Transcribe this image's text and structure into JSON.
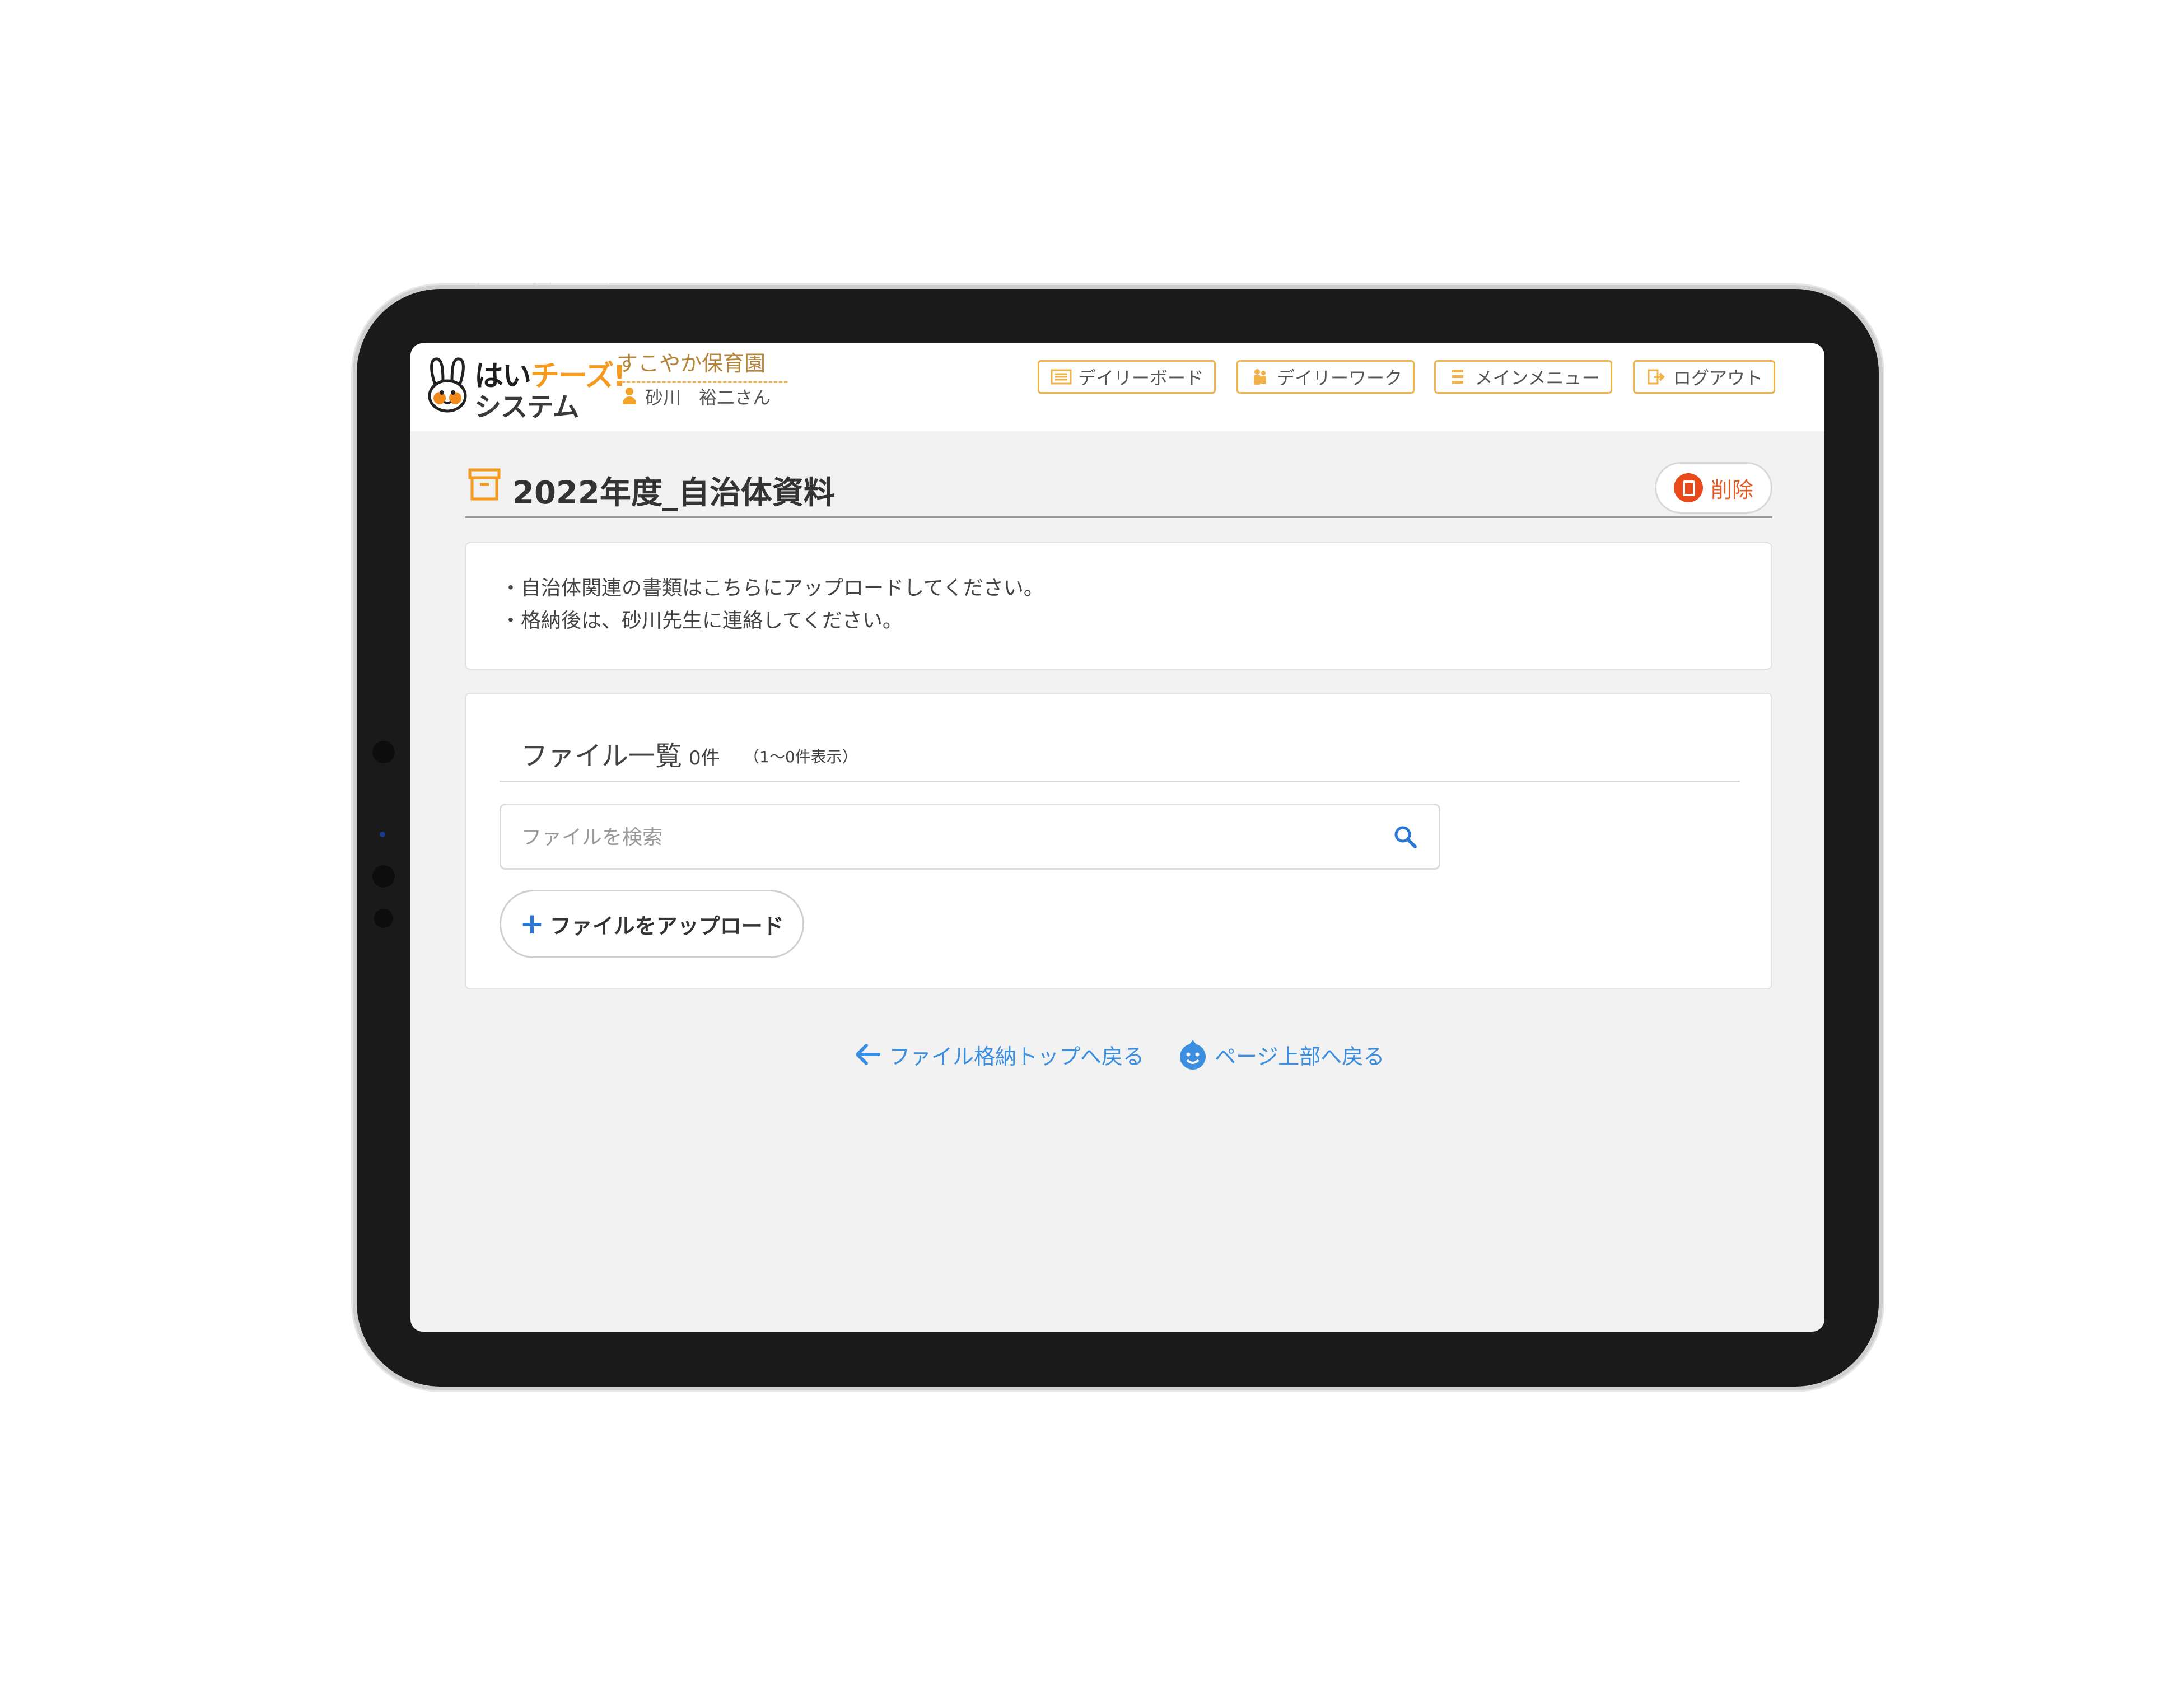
{
  "brand": {
    "logo_line1_a": "はい",
    "logo_line1_b": "チーズ!",
    "logo_line2": "システム",
    "accent_color": "#f39a1f"
  },
  "header": {
    "facility_name": "すこやか保育園",
    "user_name": "砂川　裕二さん",
    "nav": [
      {
        "label": "デイリーボード",
        "icon": "board-icon"
      },
      {
        "label": "デイリーワーク",
        "icon": "people-icon"
      },
      {
        "label": "メインメニュー",
        "icon": "menu-icon"
      },
      {
        "label": "ログアウト",
        "icon": "logout-icon"
      }
    ]
  },
  "page": {
    "title": "2022年度_自治体資料",
    "delete_label": "削除"
  },
  "notice": {
    "lines": [
      "・自治体関連の書類はこちらにアップロードしてください。",
      "・格納後は、砂川先生に連絡してください。"
    ]
  },
  "file_list": {
    "heading": "ファイル一覧",
    "count": "0件",
    "range": "（1～0件表示）",
    "search_placeholder": "ファイルを検索",
    "upload_label": "ファイルをアップロード",
    "upload_plus": "+"
  },
  "footer": {
    "back_link": "ファイル格納トップへ戻る",
    "top_link": "ページ上部へ戻る",
    "link_color": "#3c8ee0"
  }
}
